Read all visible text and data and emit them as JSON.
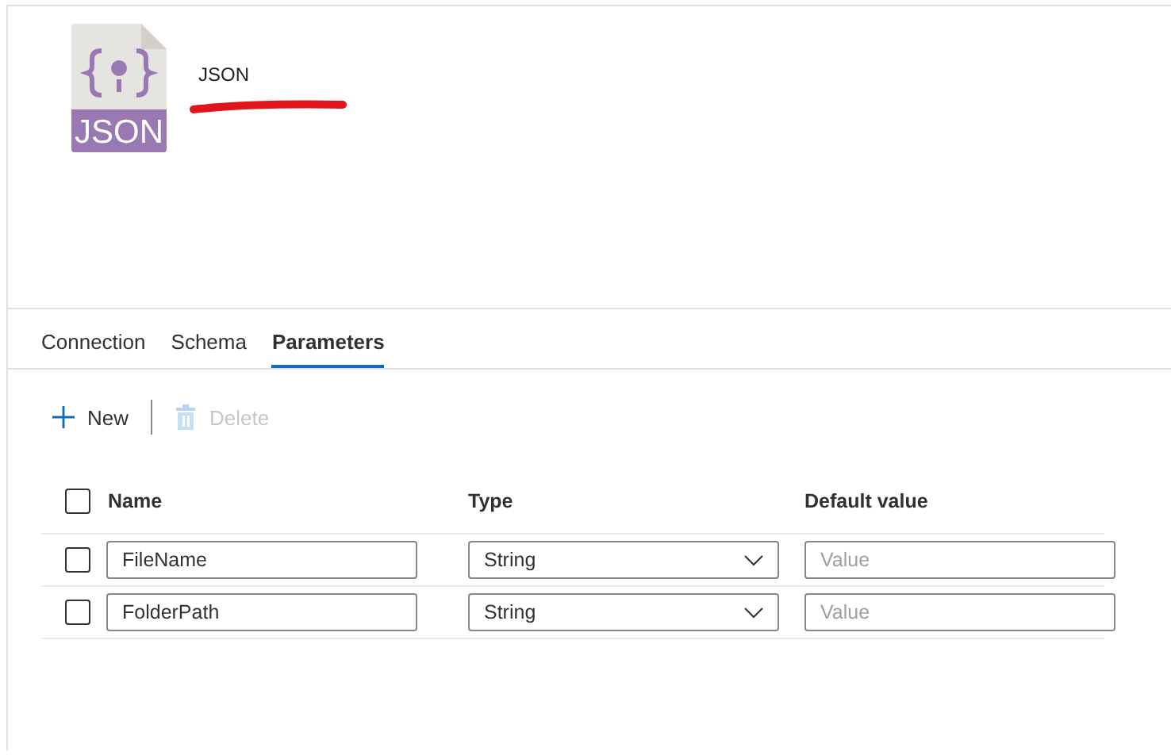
{
  "dataset": {
    "icon_label": "JSON",
    "type": "JSON",
    "name_redacted": true
  },
  "tabs": [
    {
      "label": "Connection",
      "selected": false
    },
    {
      "label": "Schema",
      "selected": false
    },
    {
      "label": "Parameters",
      "selected": true
    }
  ],
  "toolbar": [
    {
      "kind": "new",
      "label": "New",
      "disabled": false
    },
    {
      "kind": "delete",
      "label": "Delete",
      "disabled": true
    }
  ],
  "table": {
    "select_all_checked": false,
    "columns": [
      "Name",
      "Type",
      "Default value"
    ],
    "rows": [
      {
        "checked": false,
        "name": "FileName",
        "type": "String",
        "default_placeholder": "Value"
      },
      {
        "checked": false,
        "name": "FolderPath",
        "type": "String",
        "default_placeholder": "Value"
      }
    ]
  }
}
